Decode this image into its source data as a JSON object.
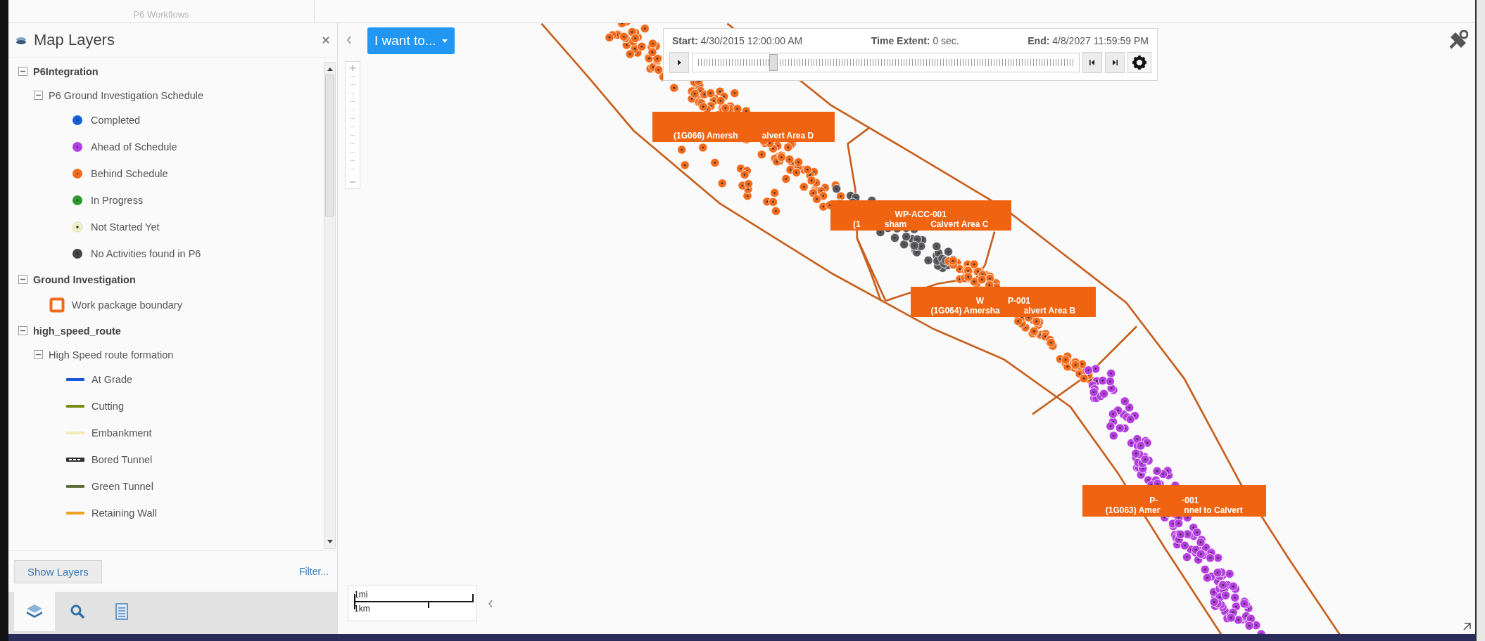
{
  "ribbon": {
    "group_label": "P6 Workflows"
  },
  "layers_panel": {
    "title": "Map Layers",
    "tree": [
      {
        "label": "P6Integration",
        "expanded": true,
        "children": [
          {
            "label": "P6 Ground Investigation Schedule",
            "expanded": true,
            "children": [
              {
                "label": "Completed",
                "kind": "dot",
                "color": "#1560d8"
              },
              {
                "label": "Ahead of Schedule",
                "kind": "dot",
                "color": "#b43ee0"
              },
              {
                "label": "Behind Schedule",
                "kind": "dot",
                "color": "#f26a1b"
              },
              {
                "label": "In Progress",
                "kind": "dot",
                "color": "#2e9a2e"
              },
              {
                "label": "Not Started Yet",
                "kind": "ring",
                "color": "#eef0c8"
              },
              {
                "label": "No Activities found in P6",
                "kind": "dot",
                "color": "#444444"
              }
            ]
          }
        ]
      },
      {
        "label": "Ground Investigation",
        "expanded": true,
        "children": [
          {
            "label": "Work package boundary",
            "kind": "square",
            "color": "#f26a1b"
          }
        ]
      },
      {
        "label": "high_speed_route",
        "expanded": true,
        "children": [
          {
            "label": "High Speed route formation",
            "expanded": true,
            "children": [
              {
                "label": "At Grade",
                "kind": "line",
                "color": "#1a56d8"
              },
              {
                "label": "Cutting",
                "kind": "line",
                "color": "#7a8c10"
              },
              {
                "label": "Embankment",
                "kind": "line",
                "color": "#f4eab8"
              },
              {
                "label": "Bored Tunnel",
                "kind": "dashed",
                "color": "#333333"
              },
              {
                "label": "Green Tunnel",
                "kind": "line",
                "color": "#5e6a3a"
              },
              {
                "label": "Retaining Wall",
                "kind": "line",
                "color": "#f0a020"
              }
            ]
          }
        ]
      }
    ],
    "show_layers_button": "Show Layers",
    "filter_link": "Filter...",
    "bottom_tabs": [
      {
        "kind": "layers",
        "selected": true
      },
      {
        "kind": "search",
        "selected": false
      },
      {
        "kind": "document",
        "selected": false
      }
    ]
  },
  "map": {
    "menu_button": "I want to...",
    "labels": [
      {
        "lines": [
          [
            "(1G066) Amersh",
            "alvert Area D"
          ]
        ]
      },
      {
        "lines": [
          [
            "WP-ACC-001"
          ],
          [
            "(1",
            "sham",
            "Calvert Area C"
          ]
        ]
      },
      {
        "lines": [
          [
            "W",
            "P-001"
          ],
          [
            "(1G064) Amersha",
            "alvert Area B"
          ]
        ]
      },
      {
        "lines": [
          [
            "P-",
            "-001"
          ],
          [
            "(1G063) Amer",
            "nnel to Calvert"
          ]
        ]
      }
    ],
    "scale_bar": {
      "top": "1mi",
      "bottom": "1km"
    }
  },
  "time_slider": {
    "start_label": "Start:",
    "start": "4/30/2015 12:00:00 AM",
    "extent_label": "Time Extent:",
    "extent": "0 sec.",
    "end_label": "End:",
    "end": "4/8/2027 11:59:59 PM",
    "level": 0.21
  }
}
